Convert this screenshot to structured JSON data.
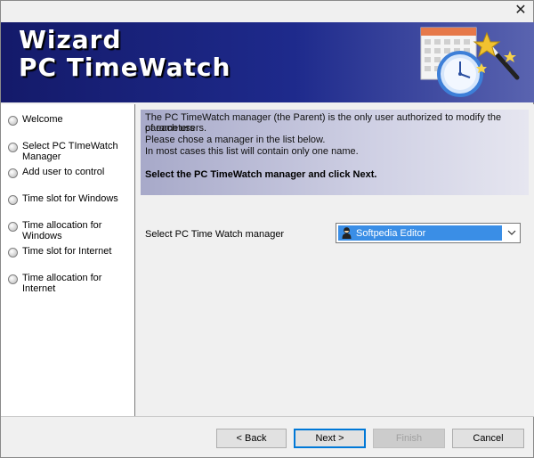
{
  "window": {
    "close_glyph": "✕"
  },
  "banner": {
    "title_line1": "Wizard",
    "title_line2": "PC TimeWatch",
    "icon": "calendar-clock-magic-wand-icon"
  },
  "sidebar": {
    "steps": [
      {
        "label": "Welcome"
      },
      {
        "label": "Select PC TImeWatch Manager"
      },
      {
        "label": "Add user to control"
      },
      {
        "label": "Time slot for Windows"
      },
      {
        "label": "Time allocation for Windows"
      },
      {
        "label": "Time slot for Internet"
      },
      {
        "label": "Time allocation for Internet"
      }
    ]
  },
  "info": {
    "line1": "The PC TimeWatch manager (the Parent) is the only user authorized to modify the parameters",
    "line2": "of each users.",
    "line3": "Please chose a manager in the list below.",
    "line4": "In most cases this list will contain only one name.",
    "instruction": "Select the PC TimeWatch manager and click Next."
  },
  "manager_select": {
    "label": "Select PC Time Watch manager",
    "selected": "Softpedia Editor",
    "icon": "user-icon"
  },
  "buttons": {
    "back": "< Back",
    "next": "Next >",
    "finish": "Finish",
    "cancel": "Cancel"
  },
  "colors": {
    "banner": "#1e2a8c",
    "selection": "#3a8ee6",
    "focus_border": "#0078d7"
  }
}
